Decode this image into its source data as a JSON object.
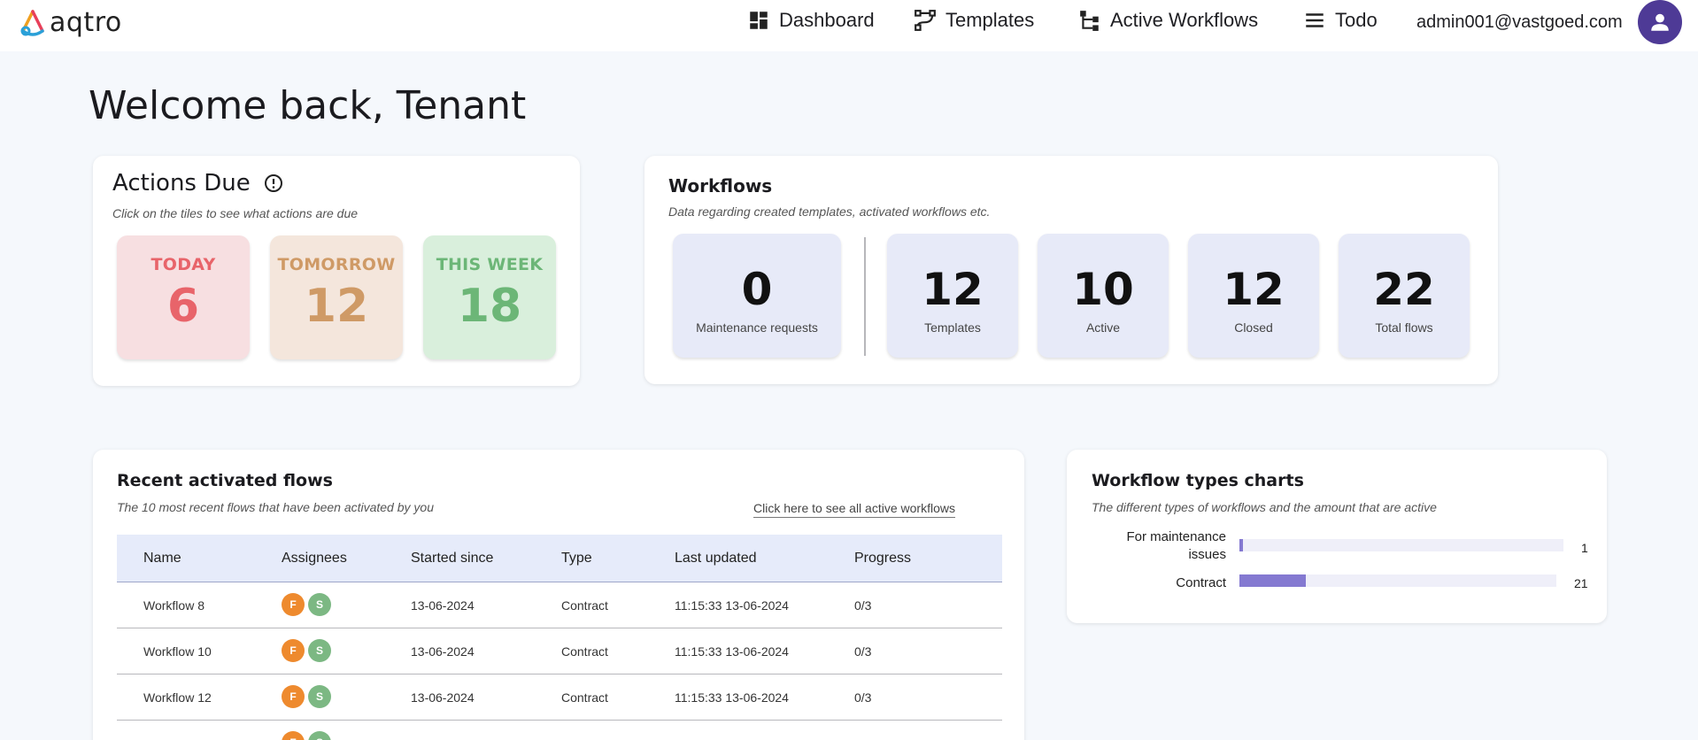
{
  "app": {
    "name": "aqtro"
  },
  "nav": {
    "items": [
      {
        "label": "Dashboard",
        "icon": "dashboard-grid-icon"
      },
      {
        "label": "Templates",
        "icon": "template-path-icon"
      },
      {
        "label": "Active Workflows",
        "icon": "workflow-tree-icon"
      },
      {
        "label": "Todo",
        "icon": "menu-lines-icon"
      }
    ],
    "user_email": "admin001@vastgoed.com",
    "avatar_icon": "person-icon"
  },
  "welcome": "Welcome back, Tenant",
  "actions_due": {
    "title": "Actions Due",
    "subtitle": "Click on the tiles to see what actions are due",
    "tiles": [
      {
        "label": "TODAY",
        "value": "6",
        "bg": "#f7dfe1",
        "color": "#e8646a"
      },
      {
        "label": "TOMORROW",
        "value": "12",
        "bg": "#f4e6dc",
        "color": "#cf9a66"
      },
      {
        "label": "THIS WEEK",
        "value": "18",
        "bg": "#d9efdc",
        "color": "#6cb677"
      }
    ]
  },
  "workflows": {
    "title": "Workflows",
    "subtitle": "Data regarding created templates, activated workflows etc.",
    "stats": [
      {
        "value": "0",
        "label": "Maintenance requests"
      },
      {
        "value": "12",
        "label": "Templates"
      },
      {
        "value": "10",
        "label": "Active"
      },
      {
        "value": "12",
        "label": "Closed"
      },
      {
        "value": "22",
        "label": "Total flows"
      }
    ]
  },
  "recent_flows": {
    "title": "Recent activated flows",
    "subtitle": "The 10 most recent flows that have been activated by you",
    "see_all_link": "Click here to see all active workflows",
    "columns": [
      "Name",
      "Assignees",
      "Started since",
      "Type",
      "Last updated",
      "Progress"
    ],
    "rows": [
      {
        "name": "Workflow 8",
        "assignees": [
          "F",
          "S"
        ],
        "started": "13-06-2024",
        "type": "Contract",
        "updated": "11:15:33 13-06-2024",
        "progress": "0/3"
      },
      {
        "name": "Workflow 10",
        "assignees": [
          "F",
          "S"
        ],
        "started": "13-06-2024",
        "type": "Contract",
        "updated": "11:15:33 13-06-2024",
        "progress": "0/3"
      },
      {
        "name": "Workflow 12",
        "assignees": [
          "F",
          "S"
        ],
        "started": "13-06-2024",
        "type": "Contract",
        "updated": "11:15:33 13-06-2024",
        "progress": "0/3"
      },
      {
        "name": "",
        "assignees": [
          "F",
          "S"
        ],
        "started": "",
        "type": "",
        "updated": "",
        "progress": ""
      }
    ],
    "badge_colors": {
      "F": "#ee8a2e",
      "S": "#7cb883"
    }
  },
  "workflow_types": {
    "title": "Workflow types charts",
    "subtitle": "The different types of workflows and the amount that are active"
  },
  "chart_data": {
    "type": "bar",
    "orientation": "horizontal",
    "categories": [
      "For maintenance issues",
      "Contract"
    ],
    "values": [
      1,
      21
    ],
    "xlim": [
      0,
      100
    ],
    "bar_color": "#8479d1",
    "track_color": "#efeff9",
    "grid": false
  }
}
